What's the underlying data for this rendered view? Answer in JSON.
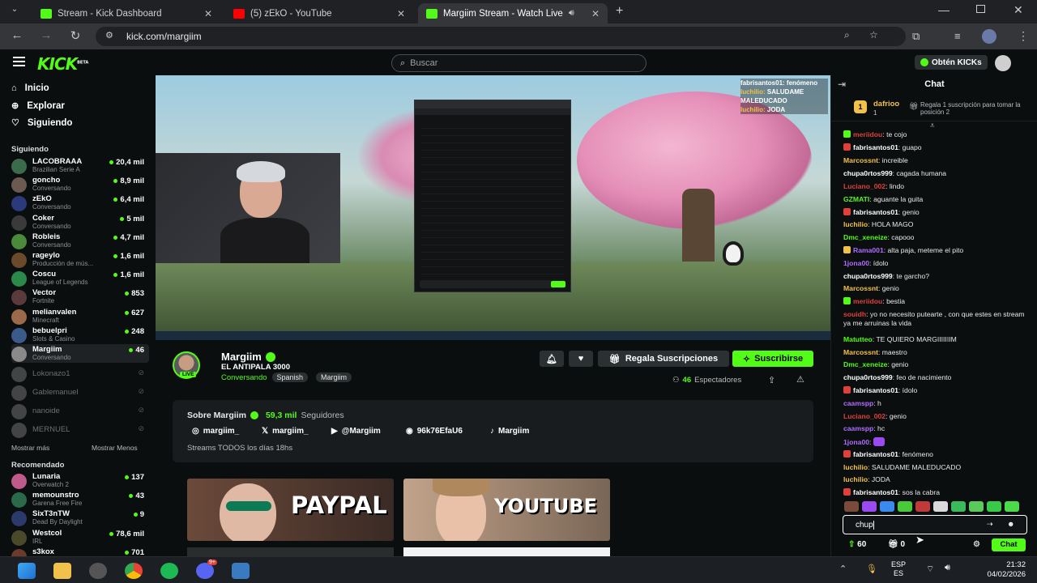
{
  "browser": {
    "tabs": [
      {
        "title": "Stream - Kick Dashboard",
        "favicon": "kick-icon",
        "color": "#53fc18"
      },
      {
        "title": "(5) zEkO - YouTube",
        "favicon": "youtube-icon",
        "color": "#ff0000"
      },
      {
        "title": "Margiim Stream - Watch Live",
        "favicon": "kick-icon",
        "color": "#53fc18"
      }
    ],
    "url": "kick.com/margiim"
  },
  "kick": {
    "logo": "KICK",
    "logo_sup": "BETA",
    "search_placeholder": "Buscar",
    "get_kicks": "Obtén KICKs"
  },
  "sidebar": {
    "nav": [
      {
        "label": "Inicio",
        "icon": "home-icon"
      },
      {
        "label": "Explorar",
        "icon": "compass-icon"
      },
      {
        "label": "Siguiendo",
        "icon": "heart-icon"
      }
    ],
    "following_title": "Siguiendo",
    "following": [
      {
        "name": "LACOBRAAA",
        "sub": "Brazilian Serie A",
        "viewers": "20,4 mil",
        "color": "#3a6b4a"
      },
      {
        "name": "goncho",
        "sub": "Conversando",
        "viewers": "8,9 mil",
        "color": "#6a5a50"
      },
      {
        "name": "zEkO",
        "sub": "Conversando",
        "viewers": "6,4 mil",
        "color": "#2a3a7a"
      },
      {
        "name": "Coker",
        "sub": "Conversando",
        "viewers": "5 mil",
        "color": "#3a3a3a"
      },
      {
        "name": "Robleis",
        "sub": "Conversando",
        "viewers": "4,7 mil",
        "color": "#4a8a3a"
      },
      {
        "name": "rageylo",
        "sub": "Producción de mús...",
        "viewers": "1,6 mil",
        "color": "#6a4a2a"
      },
      {
        "name": "Coscu",
        "sub": "League of Legends",
        "viewers": "1,6 mil",
        "color": "#2a8a4a"
      },
      {
        "name": "Vector",
        "sub": "Fortnite",
        "viewers": "853",
        "color": "#5a3a3a"
      },
      {
        "name": "melianvalen",
        "sub": "Minecraft",
        "viewers": "627",
        "color": "#9a6a4a"
      },
      {
        "name": "bebuelpri",
        "sub": "Slots & Casino",
        "viewers": "248",
        "color": "#3a5a8a"
      },
      {
        "name": "Margiim",
        "sub": "Conversando",
        "viewers": "46",
        "color": "#8a8a8a"
      }
    ],
    "offline": [
      "Lokonazo1",
      "Gablemanuel",
      "nanoide",
      "MERNUEL"
    ],
    "show_more": "Mostrar más",
    "show_less": "Mostrar Menos",
    "recommended_title": "Recomendado",
    "recommended": [
      {
        "name": "Lunaria",
        "sub": "Overwatch 2",
        "viewers": "137",
        "color": "#c05a8a"
      },
      {
        "name": "memounstro",
        "sub": "Garena Free Fire",
        "viewers": "43",
        "color": "#2a6a4a"
      },
      {
        "name": "SixT3nTW",
        "sub": "Dead By Daylight",
        "viewers": "9",
        "color": "#2a3a6a"
      },
      {
        "name": "Westcol",
        "sub": "IRL",
        "viewers": "78,6 mil",
        "color": "#4a4a2a"
      },
      {
        "name": "s3kox",
        "sub": "",
        "viewers": "701",
        "color": "#6a3a2a"
      }
    ]
  },
  "streamer": {
    "name": "Margiim",
    "title": "EL ANTIPALA 3000",
    "category": "Conversando",
    "tags": [
      "Spanish",
      "Margiim"
    ],
    "live": "LIVE",
    "viewers": "46",
    "viewers_label": "Espectadores",
    "gift_label": "Regala Suscripciones",
    "subscribe_label": "Suscribirse"
  },
  "about": {
    "title": "Sobre Margiim",
    "followers": "59,3 mil",
    "followers_label": "Seguidores",
    "socials": [
      {
        "icon": "instagram-icon",
        "label": "margiim_"
      },
      {
        "icon": "x-icon",
        "label": "margiim_"
      },
      {
        "icon": "youtube-icon",
        "label": "@Margiim"
      },
      {
        "icon": "discord-icon",
        "label": "96k76EfaU6"
      },
      {
        "icon": "tiktok-icon",
        "label": "Margiim"
      }
    ],
    "bio": "Streams TODOS los días 18hs"
  },
  "videos": [
    {
      "text": "PAYPAL"
    },
    {
      "text": "YOUTUBE"
    }
  ],
  "overlay_chat": [
    {
      "user": "fabrisantos01:",
      "text": "fenómeno"
    },
    {
      "user": "luchilio:",
      "text": "SALUDAME MALEDUCADO"
    },
    {
      "user": "luchilio:",
      "text": "JODA"
    }
  ],
  "chat": {
    "title": "Chat",
    "top_donor": {
      "name": "dafrioo",
      "count": "1",
      "text": "Regala 1 suscripción para tomar la posición 2"
    },
    "messages": [
      {
        "user": "meriidou",
        "text": "te cojo",
        "color": "#e0403a",
        "badge": "#53fc18"
      },
      {
        "user": "fabrisantos01",
        "text": "guapo",
        "color": "#ffffff",
        "badge": "#e0403a"
      },
      {
        "user": "Marcossnt",
        "text": "increible",
        "color": "#f2c14b",
        "badge": ""
      },
      {
        "user": "chupa0rtos999",
        "text": "cagada humana",
        "color": "#ffffff",
        "badge": ""
      },
      {
        "user": "Luciano_002",
        "text": "lindo",
        "color": "#e0403a",
        "badge": ""
      },
      {
        "user": "GZMATI",
        "text": "aguante la guita",
        "color": "#53fc18",
        "badge": ""
      },
      {
        "user": "fabrisantos01",
        "text": "genio",
        "color": "#ffffff",
        "badge": "#e0403a"
      },
      {
        "user": "luchilio",
        "text": "HOLA MAGO",
        "color": "#f2c14b",
        "badge": ""
      },
      {
        "user": "Dmc_xeneize",
        "text": "capooo",
        "color": "#53fc18",
        "badge": ""
      },
      {
        "user": "Rama001",
        "text": "alta paja, meteme el pito",
        "color": "#b06cff",
        "badge": "#f2c14b"
      },
      {
        "user": "1jona00",
        "text": "ídolo",
        "color": "#b06cff",
        "badge": ""
      },
      {
        "user": "chupa0rtos999",
        "text": "te garcho?",
        "color": "#ffffff",
        "badge": ""
      },
      {
        "user": "Marcossnt",
        "text": "genio",
        "color": "#f2c14b",
        "badge": ""
      },
      {
        "user": "meriidou",
        "text": "bestia",
        "color": "#e0403a",
        "badge": "#53fc18"
      },
      {
        "user": "souidh",
        "text": "yo no necesito putearte , con que estes en stream ya me arruinas la vida",
        "color": "#e0403a",
        "badge": ""
      },
      {
        "user": "Matutteo",
        "text": "TE QUIERO MARGIIIIIIIM",
        "color": "#53fc18",
        "badge": ""
      },
      {
        "user": "Marcossnt",
        "text": "maestro",
        "color": "#f2c14b",
        "badge": ""
      },
      {
        "user": "Dmc_xeneize",
        "text": "genio",
        "color": "#53fc18",
        "badge": ""
      },
      {
        "user": "chupa0rtos999",
        "text": "feo de nacimiento",
        "color": "#ffffff",
        "badge": ""
      },
      {
        "user": "fabrisantos01",
        "text": "ídolo",
        "color": "#ffffff",
        "badge": "#e0403a"
      },
      {
        "user": "caamspp",
        "text": "h",
        "color": "#b06cff",
        "badge": ""
      },
      {
        "user": "Luciano_002",
        "text": "genio",
        "color": "#e0403a",
        "badge": ""
      },
      {
        "user": "caamspp",
        "text": "hc",
        "color": "#b06cff",
        "badge": ""
      },
      {
        "user": "1jona00",
        "text": "",
        "color": "#b06cff",
        "badge": ""
      },
      {
        "user": "fabrisantos01",
        "text": "fenómeno",
        "color": "#ffffff",
        "badge": "#e0403a"
      },
      {
        "user": "luchilio",
        "text": "SALUDAME MALEDUCADO",
        "color": "#f2c14b",
        "badge": ""
      },
      {
        "user": "luchilio",
        "text": "JODA",
        "color": "#f2c14b",
        "badge": ""
      },
      {
        "user": "fabrisantos01",
        "text": "sos la cabra",
        "color": "#ffffff",
        "badge": "#e0403a"
      }
    ],
    "input_value": "chup",
    "kicks": "60",
    "gifts": "0",
    "send_label": "Chat"
  },
  "taskbar": {
    "lang_top": "ESP",
    "lang_bottom": "ES",
    "time": "21:32",
    "date": "04/02/2026",
    "discord_badge": "9+"
  }
}
